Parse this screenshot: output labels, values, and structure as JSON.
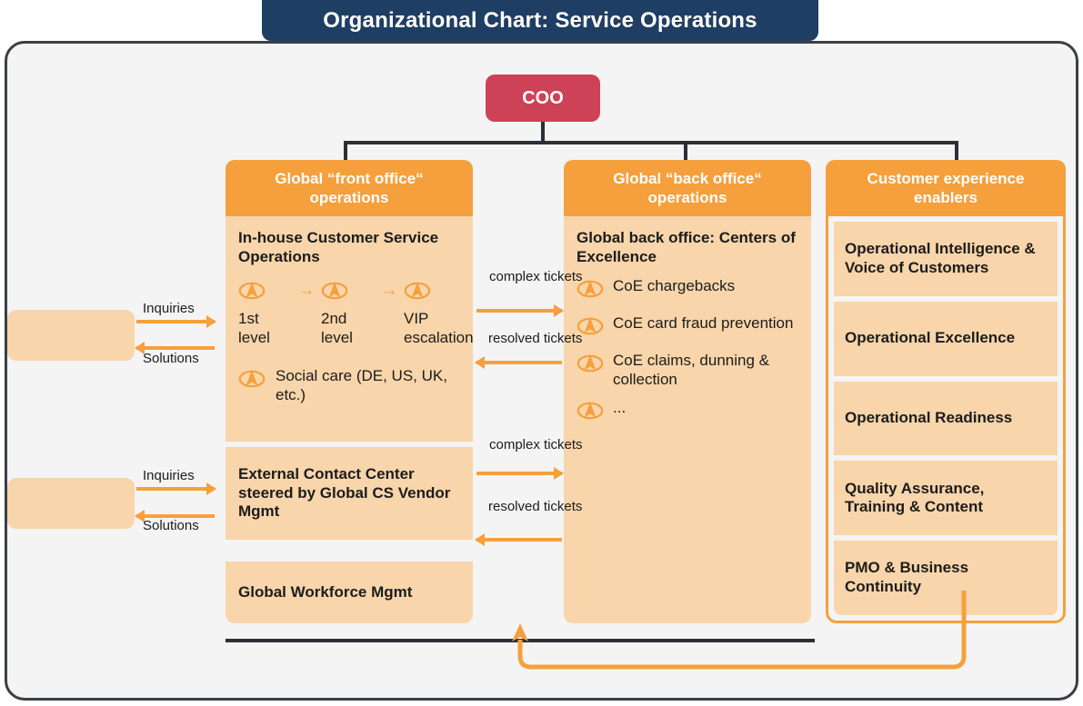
{
  "title": "Organizational Chart: Service Operations",
  "root": {
    "label": "COO"
  },
  "colors": {
    "title_bar": "#1F3E63",
    "root_node": "#CD4257",
    "header_orange": "#F5A03C",
    "body_peach": "#F8D5AA",
    "frame_border": "#3A3F47",
    "canvas": "#F4F4F4"
  },
  "columns": [
    {
      "header": "Global “front office“ operations",
      "blocks": [
        {
          "title": "In-house Customer Service Operations",
          "levels": [
            {
              "icon": "agent-headset-icon",
              "label": "1st level"
            },
            {
              "icon": "agent-headset-icon",
              "label": "2nd level"
            },
            {
              "icon": "agent-headset-icon",
              "label": "VIP escalation"
            }
          ],
          "level_arrow": "→",
          "extra": {
            "icon": "agent-headset-icon",
            "label": "Social care (DE, US, UK, etc.)"
          }
        },
        {
          "title": "External Contact Center steered by Global CS Vendor Mgmt"
        },
        {
          "title": "Global Workforce Mgmt"
        }
      ]
    },
    {
      "header": "Global “back office“ operations",
      "blocks": [
        {
          "title": "Global back office: Centers of Excellence",
          "items": [
            {
              "icon": "agent-headset-icon",
              "label": "CoE chargebacks"
            },
            {
              "icon": "agent-headset-icon",
              "label": "CoE card fraud prevention"
            },
            {
              "icon": "agent-headset-icon",
              "label": "CoE claims, dunning & collection"
            },
            {
              "icon": "agent-headset-icon",
              "label": "..."
            }
          ]
        }
      ]
    },
    {
      "header": "Customer experience enablers",
      "enablers": [
        "Operational Intelligence & Voice of Customers",
        "Operational Excellence",
        "Operational Readiness",
        "Quality Assurance, Training & Content",
        "PMO & Business Continuity"
      ]
    }
  ],
  "flows": {
    "left_top": {
      "out": "Inquiries",
      "back": "Solutions"
    },
    "left_bottom": {
      "out": "Inquiries",
      "back": "Solutions"
    },
    "mid_top": {
      "out": "complex tickets",
      "back": "resolved tickets"
    },
    "mid_bottom": {
      "out": "complex tickets",
      "back": "resolved tickets"
    }
  },
  "sources": [
    {
      "label": ""
    },
    {
      "label": ""
    }
  ]
}
